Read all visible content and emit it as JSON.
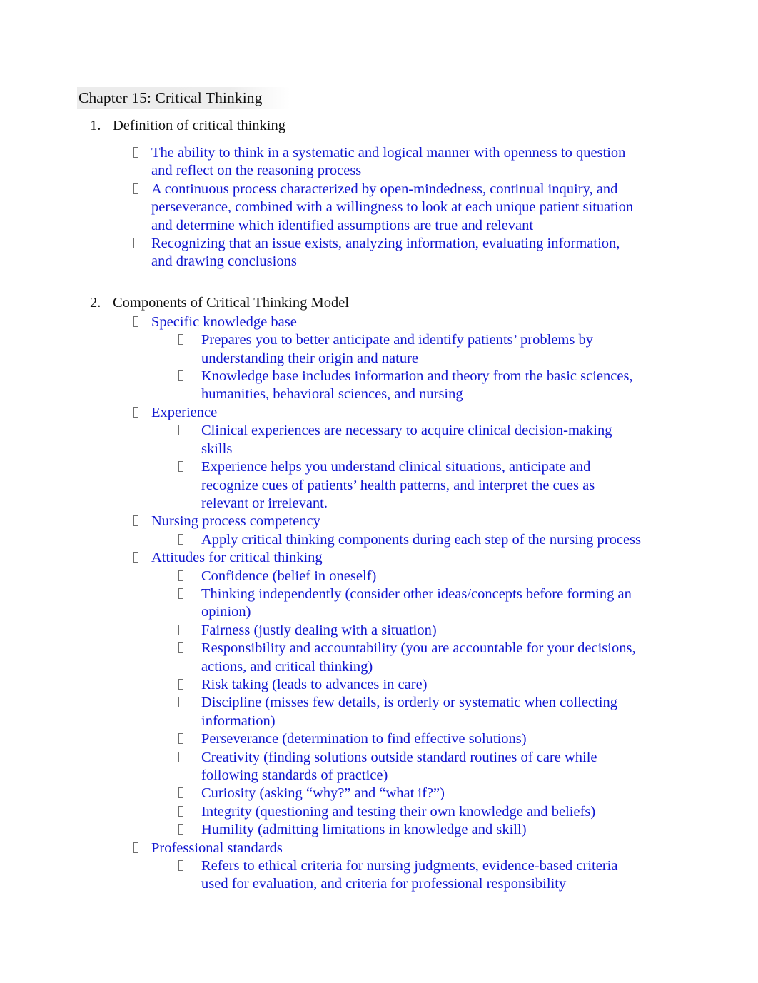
{
  "document": {
    "title": "Chapter 15: Critical Thinking",
    "title_highlight_color": "#e9e9e9",
    "body_text_color": "#1016cf",
    "heading_text_color": "#111111",
    "bullet_glyph": "missing-glyph-box"
  },
  "sections": [
    {
      "number": "1.",
      "heading": "Definition of critical thinking",
      "bullets": [
        {
          "text": "The ability to think in a systematic and logical manner with openness to question and reflect on the reasoning process",
          "children": []
        },
        {
          "text": "A continuous process characterized by open-mindedness, continual inquiry, and perseverance, combined with a willingness to look at each unique patient situation and determine which identified assumptions are true and relevant",
          "children": []
        },
        {
          "text": "Recognizing that an issue exists, analyzing information, evaluating information, and drawing conclusions",
          "children": []
        }
      ]
    },
    {
      "number": "2.",
      "heading": "Components of Critical Thinking Model",
      "bullets": [
        {
          "text": "Specific knowledge base",
          "children": [
            "Prepares you to better anticipate and identify patients’ problems by understanding their origin and nature",
            "Knowledge base includes information and theory from the basic sciences, humanities, behavioral sciences, and nursing"
          ]
        },
        {
          "text": "Experience",
          "children": [
            "Clinical experiences are necessary to acquire clinical decision-making skills",
            "Experience helps you understand clinical situations, anticipate and recognize cues of patients’ health patterns, and interpret the cues as relevant or irrelevant."
          ]
        },
        {
          "text": "Nursing process competency",
          "children": [
            "Apply critical thinking components during each step of the nursing process"
          ]
        },
        {
          "text": "Attitudes for critical thinking",
          "children": [
            "Confidence (belief in oneself)",
            "Thinking independently (consider other ideas/concepts before forming an opinion)",
            "Fairness (justly dealing with a situation)",
            "Responsibility and accountability (you are accountable for your decisions, actions, and critical thinking)",
            "Risk taking (leads to advances in care)",
            "Discipline (misses few details, is orderly or systematic when collecting information)",
            "Perseverance (determination to find effective solutions)",
            "Creativity (finding solutions outside standard routines of care while following standards of practice)",
            "Curiosity (asking “why?” and “what if?”)",
            "Integrity (questioning and testing their own knowledge and beliefs)",
            "Humility (admitting limitations in knowledge and skill)"
          ]
        },
        {
          "text": "Professional standards",
          "children": [
            "Refers to ethical criteria for nursing judgments, evidence-based criteria used for evaluation, and criteria for professional responsibility"
          ]
        }
      ]
    }
  ]
}
